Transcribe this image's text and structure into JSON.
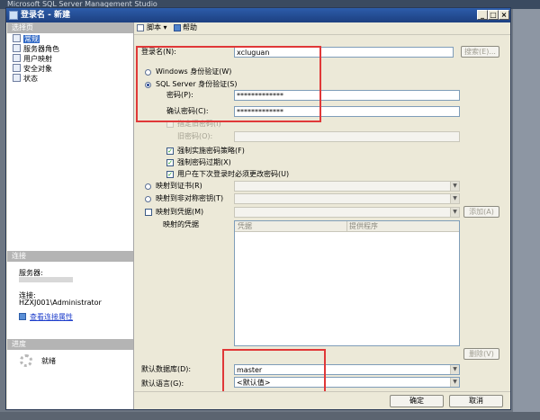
{
  "background_app_title": "Microsoft SQL Server Management Studio",
  "dialog": {
    "title": "登录名 - 新建"
  },
  "left_pane": {
    "select_page_header": "选择页",
    "pages": [
      "常规",
      "服务器角色",
      "用户映射",
      "安全对象",
      "状态"
    ],
    "selected_page": "常规",
    "connection_header": "连接",
    "server_label": "服务器:",
    "server_value": "",
    "connection_label": "连接:",
    "connection_value": "HZXJ001\\Administrator",
    "view_connection_link": "查看连接属性",
    "progress_header": "进度",
    "progress_status": "就绪"
  },
  "toolbar": {
    "script_label": "脚本",
    "help_label": "帮助"
  },
  "form": {
    "login_name_label": "登录名(N):",
    "login_name_value": "xcluguan",
    "search_button": "搜索(E)...",
    "auth_windows": "Windows 身份验证(W)",
    "auth_sql": "SQL Server 身份验证(S)",
    "selected_auth": "SQL Server 身份验证(S)",
    "password_label": "密码(P):",
    "password_value": "*************",
    "confirm_label": "确认密码(C):",
    "confirm_value": "*************",
    "specify_old_password": "指定旧密码(I)",
    "old_password_label": "旧密码(O):",
    "old_password_value": "",
    "enforce_policy": "强制实施密码策略(F)",
    "enforce_expiration": "强制密码过期(X)",
    "must_change": "用户在下次登录时必须更改密码(U)",
    "map_cert": "映射到证书(R)",
    "map_asym_key": "映射到非对称密钥(T)",
    "map_credential": "映射到凭据(M)",
    "add_button": "添加(A)",
    "mapped_credentials_label": "映射的凭据",
    "grid_headers": [
      "凭据",
      "提供程序"
    ],
    "remove_button": "删除(V)",
    "default_db_label": "默认数据库(D):",
    "default_db_value": "master",
    "default_lang_label": "默认语言(G):",
    "default_lang_value": "<默认值>"
  },
  "buttons": {
    "ok": "确定",
    "cancel": "取消"
  },
  "colors": {
    "title_bar": "#1d3f80",
    "highlight_box": "#e03838",
    "selection": "#3169c6"
  }
}
